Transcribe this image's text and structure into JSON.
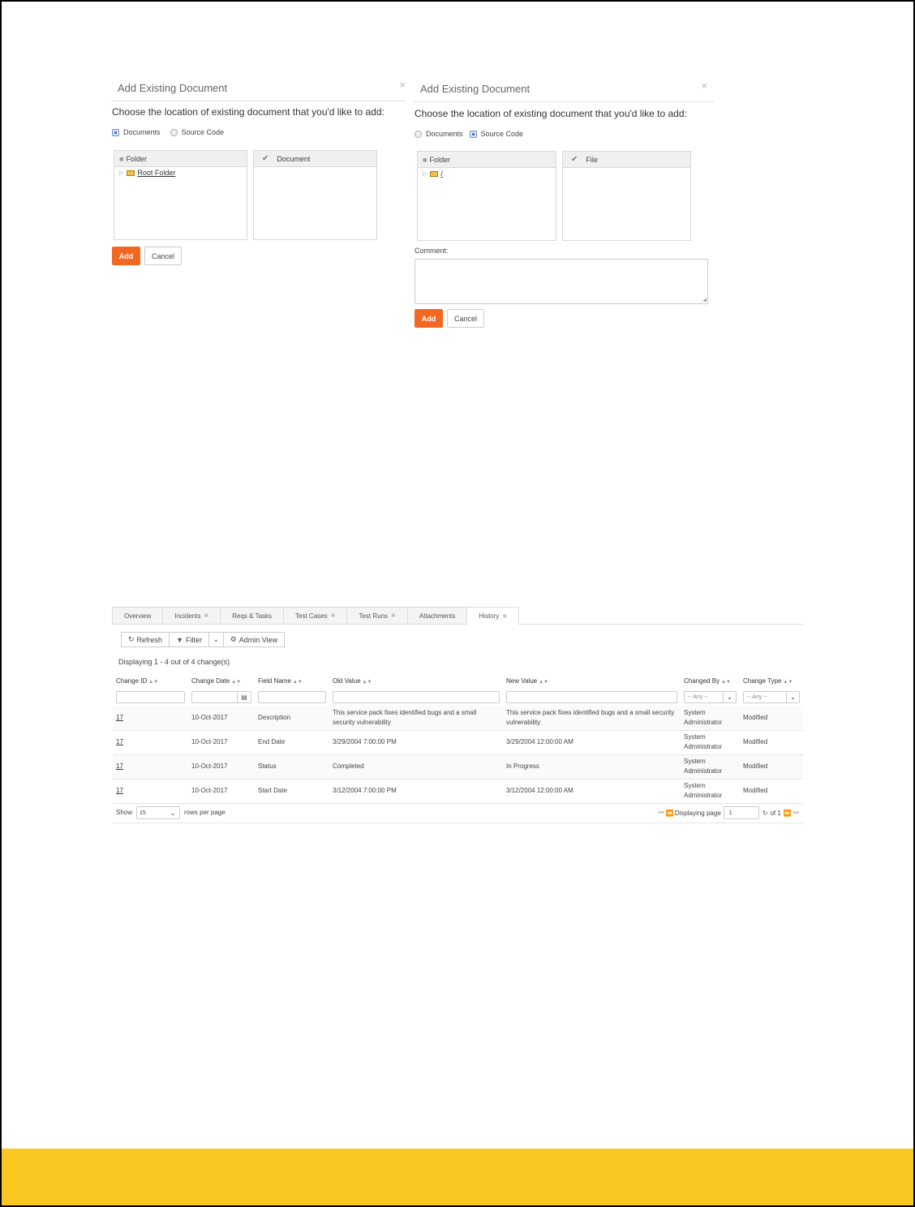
{
  "dialog_left": {
    "title": "Add Existing Document",
    "close_symbol": "×",
    "instruction": "Choose the location of existing document that you'd like to add:",
    "radio_documents": "Documents",
    "radio_source_code": "Source Code",
    "selected": "Documents",
    "folder_header": "Folder",
    "document_header": "Document",
    "tree_root": "Root Folder",
    "add_label": "Add",
    "cancel_label": "Cancel"
  },
  "dialog_right": {
    "title": "Add Existing Document",
    "close_symbol": "×",
    "instruction": "Choose the location of existing document that you'd like to add:",
    "radio_documents": "Documents",
    "radio_source_code": "Source Code",
    "selected": "Source Code",
    "folder_header": "Folder",
    "file_header": "File",
    "tree_root": "/",
    "comment_label": "Comment:",
    "add_label": "Add",
    "cancel_label": "Cancel"
  },
  "history": {
    "tabs": [
      {
        "label": "Overview",
        "star": false
      },
      {
        "label": "Incidents",
        "star": true
      },
      {
        "label": "Reqs & Tasks",
        "star": false
      },
      {
        "label": "Test Cases",
        "star": true
      },
      {
        "label": "Test Runs",
        "star": true
      },
      {
        "label": "Attachments",
        "star": false
      },
      {
        "label": "History",
        "star": true,
        "active": true
      }
    ],
    "toolbar": {
      "refresh": "Refresh",
      "filter": "Filter",
      "admin_view": "Admin View"
    },
    "displaying": "Displaying 1 - 4 out of 4 change(s)",
    "columns": [
      "Change ID",
      "Change Date",
      "Field Name",
      "Old Value",
      "New Value",
      "Changed By",
      "Change Type"
    ],
    "filter_any": "-- Any --",
    "rows": [
      {
        "id": "17",
        "date": "10-Oct-2017",
        "field": "Description",
        "old": "This service pack fixes identified bugs and a small security vulnerability",
        "new": "This service pack fixes identified bugs and a small security vulnerability",
        "by": "System Administrator",
        "type": "Modified"
      },
      {
        "id": "17",
        "date": "10-Oct-2017",
        "field": "End Date",
        "old": "3/29/2004 7:00:00 PM",
        "new": "3/29/2004 12:00:00 AM",
        "by": "System Administrator",
        "type": "Modified"
      },
      {
        "id": "17",
        "date": "10-Oct-2017",
        "field": "Status",
        "old": "Completed",
        "new": "In Progress",
        "by": "System Administrator",
        "type": "Modified"
      },
      {
        "id": "17",
        "date": "10-Oct-2017",
        "field": "Start Date",
        "old": "3/12/2004 7:00:00 PM",
        "new": "3/12/2004 12:00:00 AM",
        "by": "System Administrator",
        "type": "Modified"
      }
    ],
    "pager": {
      "show": "Show",
      "rows_value": "15",
      "rows_per_page": "rows per page",
      "displaying_page": "Displaying page",
      "page_value": "1",
      "of_total": "of 1"
    }
  },
  "colors": {
    "accent_orange": "#f26722",
    "footer_yellow": "#fbc822"
  }
}
